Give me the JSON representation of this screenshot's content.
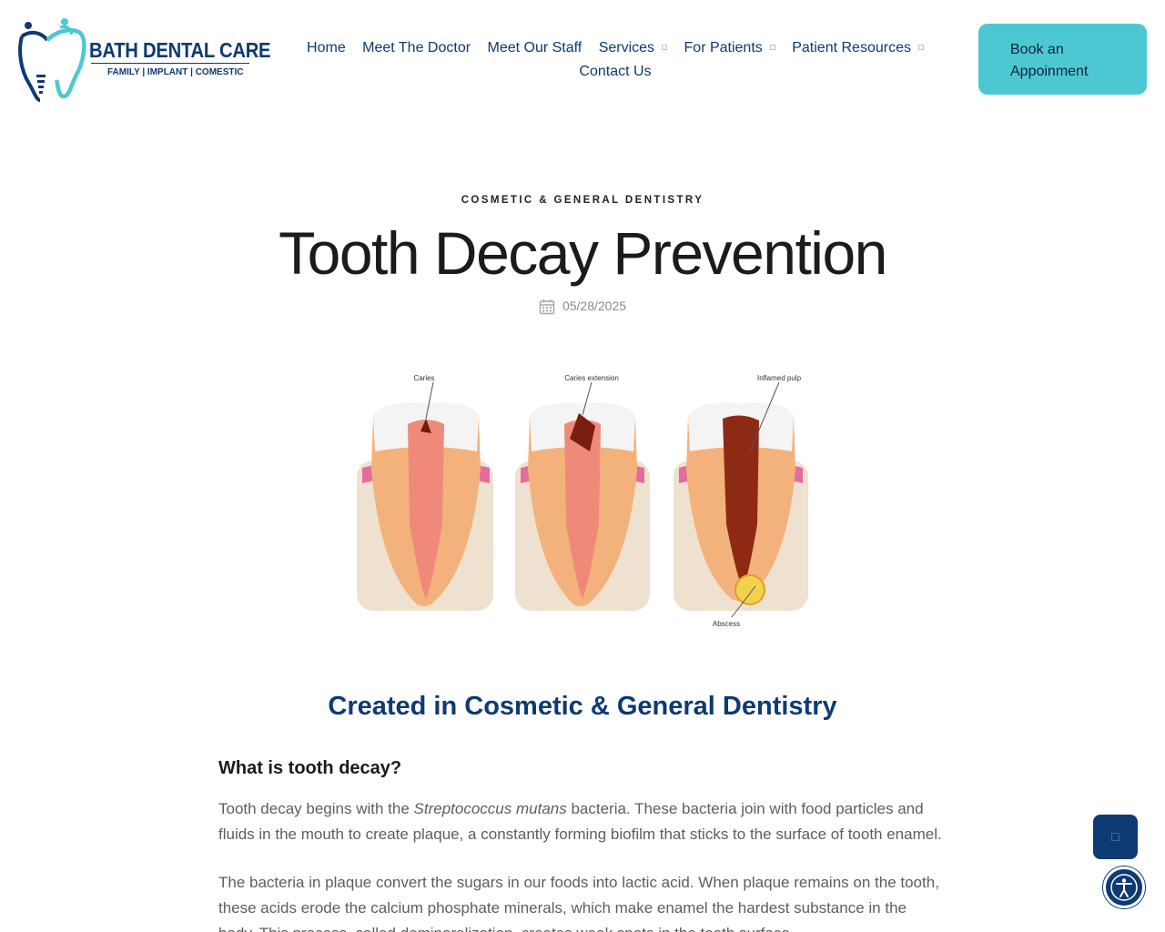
{
  "brand": {
    "name": "BATH DENTAL CARE",
    "tagline": "FAMILY | IMPLANT | COMESTIC",
    "colors": {
      "primary": "#0d3a73",
      "accent": "#4cc8d3"
    }
  },
  "nav": {
    "home": "Home",
    "meet_doctor": "Meet The Doctor",
    "meet_staff": "Meet Our Staff",
    "services": "Services",
    "for_patients": "For Patients",
    "patient_resources": "Patient Resources",
    "contact": "Contact Us"
  },
  "book_button": {
    "line1": "Book an",
    "line2": "Appoinment"
  },
  "article": {
    "category": "COSMETIC & GENERAL DENTISTRY",
    "title": "Tooth Decay Prevention",
    "date": "05/28/2025",
    "date_icon": "calendar-icon",
    "hero_labels": {
      "caries": "Caries",
      "caries_extension": "Caries extension",
      "inflamed_pulp": "Inflamed pulp",
      "abscess": "Abscess"
    },
    "created_in": "Created in Cosmetic & General Dentistry",
    "section_heading": "What is tooth decay?",
    "p1_a": "Tooth decay begins with the ",
    "p1_em": "Streptococcus mutans",
    "p1_b": " bacteria. These bacteria join with food particles and fluids in the mouth to create plaque, a constantly forming biofilm that sticks to the surface of tooth enamel.",
    "p2": "The bacteria in plaque convert the sugars in our foods into lactic acid. When plaque remains on the tooth, these acids erode the calcium phosphate minerals, which make enamel the hardest substance in the body. This process, called demineralization, creates weak spots in the tooth surface."
  },
  "floating": {
    "chat_icon": "chat-icon",
    "accessibility_icon": "accessibility-icon"
  }
}
